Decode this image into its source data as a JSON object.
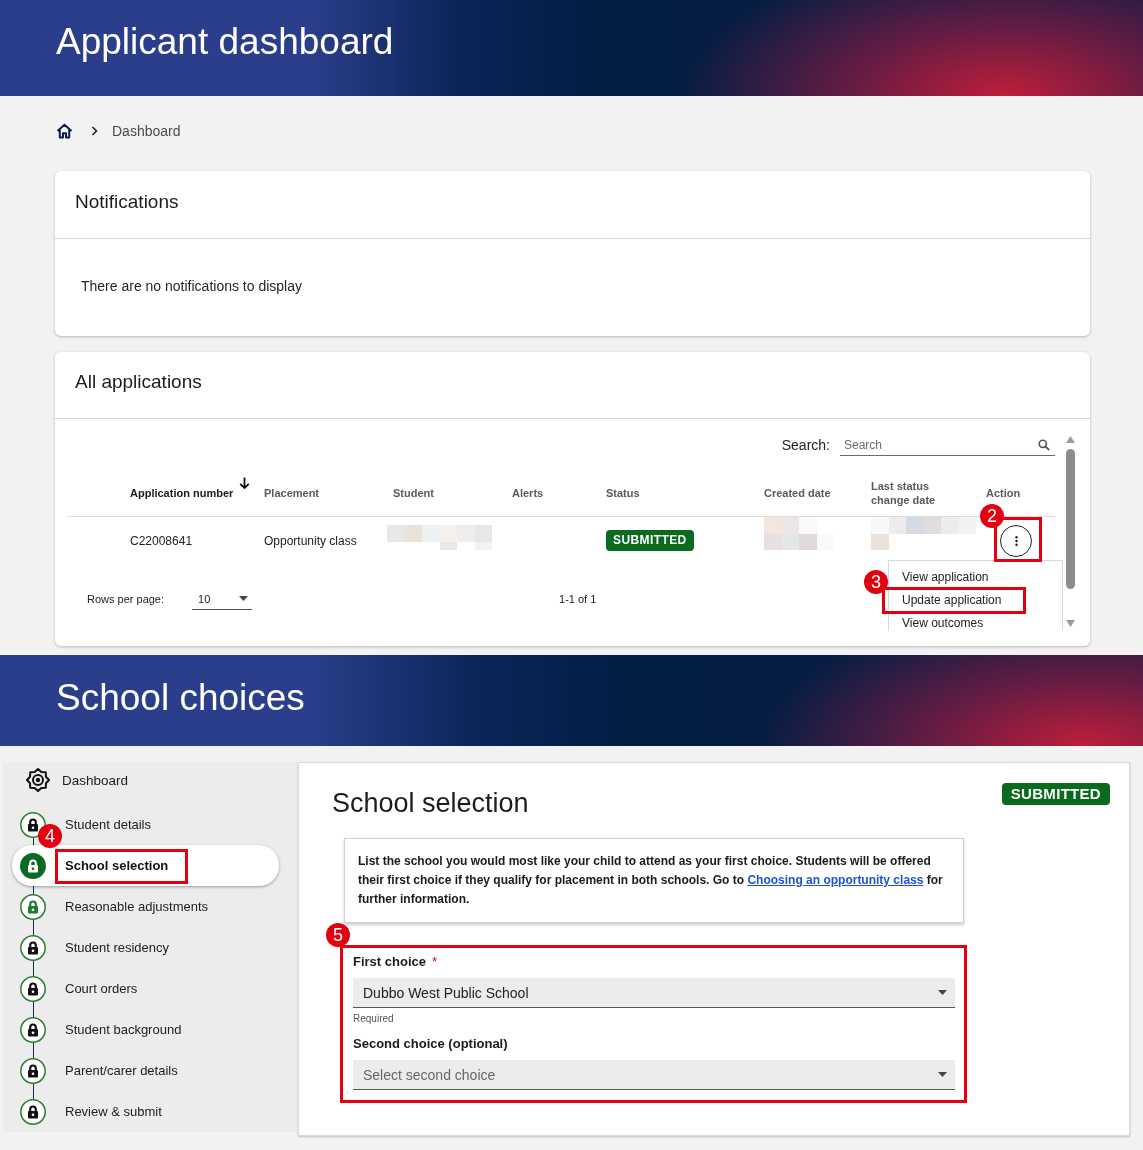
{
  "dashboard": {
    "banner": {
      "title": "Applicant dashboard"
    },
    "breadcrumb": [
      "Dashboard"
    ],
    "notifications": {
      "title": "Notifications",
      "message": "There are no notifications to display"
    },
    "applications": {
      "title": "All applications",
      "search": {
        "label": "Search:",
        "placeholder": "Search"
      },
      "table": {
        "columns": [
          {
            "label": "Application number",
            "sorted": true
          },
          {
            "label": "Placement",
            "sorted": false
          },
          {
            "label": "Student",
            "sorted": false
          },
          {
            "label": "Alerts",
            "sorted": false
          },
          {
            "label": "Status",
            "sorted": false
          },
          {
            "label": "Created date",
            "sorted": false
          },
          {
            "label": "Last status change date",
            "sorted": false
          },
          {
            "label": "Action",
            "sorted": false
          }
        ],
        "rows": [
          {
            "cells": [
              {
                "kind": "text",
                "text": "C22008641"
              },
              {
                "kind": "text",
                "text": "Opportunity class"
              },
              {
                "kind": "redacted"
              },
              {
                "kind": "empty"
              },
              {
                "kind": "status",
                "text": "SUBMITTED"
              },
              {
                "kind": "redacted"
              },
              {
                "kind": "redacted"
              },
              {
                "kind": "action",
                "callout": "2",
                "menu": [
                  {
                    "label": "View application"
                  },
                  {
                    "label": "Update application",
                    "callout": "3"
                  },
                  {
                    "label": "View outcomes"
                  }
                ]
              }
            ]
          }
        ]
      },
      "pagination": {
        "rows_per_page_label": "Rows per page:",
        "rows_per_page": "10",
        "range": "1-1 of 1"
      }
    }
  },
  "school_choices": {
    "banner": {
      "title": "School choices"
    },
    "sidebar": {
      "dashboard_link": "Dashboard",
      "steps": [
        {
          "label": "Student details",
          "selected": false,
          "color": "#111111"
        },
        {
          "label": "School selection",
          "selected": true,
          "color": "#ffffff",
          "callout": "4"
        },
        {
          "label": "Reasonable adjustments",
          "selected": false,
          "color": "#1e7b34"
        },
        {
          "label": "Student residency",
          "selected": false,
          "color": "#111111"
        },
        {
          "label": "Court orders",
          "selected": false,
          "color": "#111111"
        },
        {
          "label": "Student background",
          "selected": false,
          "color": "#111111"
        },
        {
          "label": "Parent/carer details",
          "selected": false,
          "color": "#111111"
        },
        {
          "label": "Review & submit",
          "selected": false,
          "color": "#111111"
        }
      ]
    },
    "section": {
      "title": "School selection",
      "status": "SUBMITTED",
      "info": {
        "text_before": "List the school you would most like your child to attend as your first choice. Students will be offered their first choice if they qualify for placement in both schools. Go to",
        "link": "Choosing an opportunity class",
        "text_after": "for further information."
      },
      "form": {
        "callout": "5",
        "fields": [
          {
            "label": "First choice",
            "required_mark": "*",
            "value": "Dubbo West Public School",
            "helper": "Required"
          },
          {
            "label": "Second choice (optional)",
            "placeholder": "Select second choice"
          }
        ]
      }
    }
  }
}
